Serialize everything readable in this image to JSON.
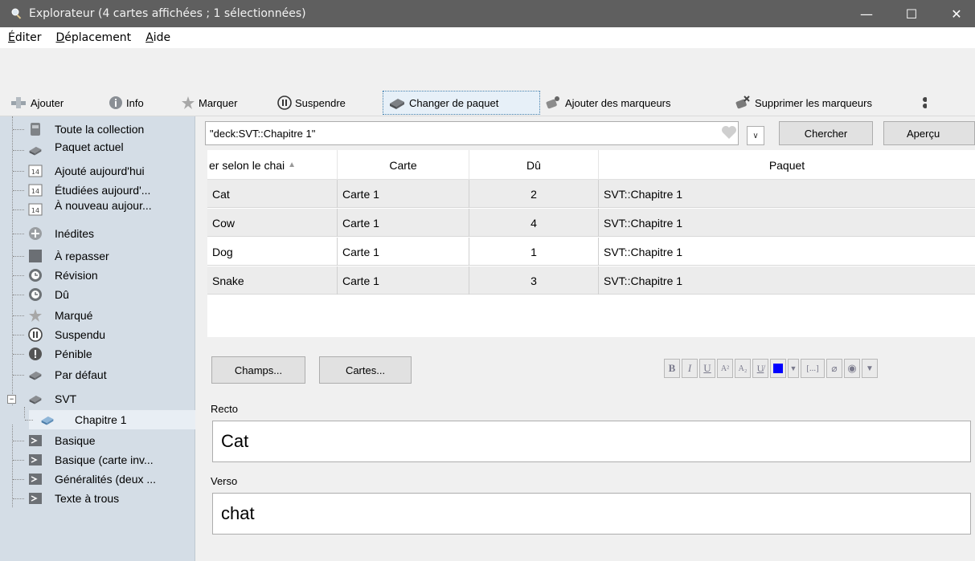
{
  "window": {
    "title": "Explorateur (4 cartes affichées ; 1 sélectionnées)",
    "minimize": "—",
    "maximize": "☐",
    "close": "✕"
  },
  "menu": {
    "edit": {
      "u": "É",
      "rest": "diter"
    },
    "move": {
      "u": "D",
      "rest": "éplacement"
    },
    "help": {
      "u": "A",
      "rest": "ide"
    }
  },
  "toolbar": {
    "add": "Ajouter",
    "info": "Info",
    "mark": "Marquer",
    "suspend": "Suspendre",
    "change_deck": "Changer de paquet",
    "add_tags": "Ajouter des marqueurs",
    "remove_tags": "Supprimer les marqueurs"
  },
  "sidebar": {
    "items": [
      {
        "label": "Toute la collection",
        "icon": "collection-icon"
      },
      {
        "label": "Paquet actuel",
        "icon": "deck-icon"
      },
      {
        "label": "Ajouté aujourd'hui",
        "icon": "calendar-icon"
      },
      {
        "label": "Étudiées aujourd'...",
        "icon": "calendar-icon"
      },
      {
        "label": "À nouveau aujour...",
        "icon": "calendar-icon"
      },
      {
        "label": "Inédites",
        "icon": "plus-icon"
      },
      {
        "label": "À repasser",
        "icon": "square-icon"
      },
      {
        "label": "Révision",
        "icon": "clock-icon"
      },
      {
        "label": "Dû",
        "icon": "clock-icon"
      },
      {
        "label": "Marqué",
        "icon": "star-icon"
      },
      {
        "label": "Suspendu",
        "icon": "pause-icon"
      },
      {
        "label": "Pénible",
        "icon": "warning-icon"
      },
      {
        "label": "Par défaut",
        "icon": "deck-icon"
      },
      {
        "label": "SVT",
        "icon": "deck-icon"
      },
      {
        "label": "Chapitre 1",
        "icon": "deck-icon"
      },
      {
        "label": "Basique",
        "icon": "note-type-icon"
      },
      {
        "label": "Basique (carte inv...",
        "icon": "note-type-icon"
      },
      {
        "label": "Généralités (deux ...",
        "icon": "note-type-icon"
      },
      {
        "label": "Texte à trous",
        "icon": "note-type-icon"
      }
    ]
  },
  "search": {
    "value": "\"deck:SVT::Chapitre 1\"",
    "search_button": "Chercher",
    "preview_button": "Aperçu"
  },
  "table": {
    "headers": [
      "er selon le chai",
      "Carte",
      "Dû",
      "Paquet"
    ],
    "rows": [
      [
        "Cat",
        "Carte 1",
        "2",
        "SVT::Chapitre 1"
      ],
      [
        "Cow",
        "Carte 1",
        "4",
        "SVT::Chapitre 1"
      ],
      [
        "Dog",
        "Carte 1",
        "1",
        "SVT::Chapitre 1"
      ],
      [
        "Snake",
        "Carte 1",
        "3",
        "SVT::Chapitre 1"
      ]
    ]
  },
  "editor": {
    "fields_button": "Champs...",
    "cards_button": "Cartes...",
    "format": {
      "bold": "B",
      "italic": "I",
      "underline": "U",
      "sup": "A²",
      "sub": "A₂",
      "cloze": "[...]"
    },
    "front_label": "Recto",
    "front_value": "Cat",
    "back_label": "Verso",
    "back_value": "chat",
    "text_color": "#0000ff"
  }
}
